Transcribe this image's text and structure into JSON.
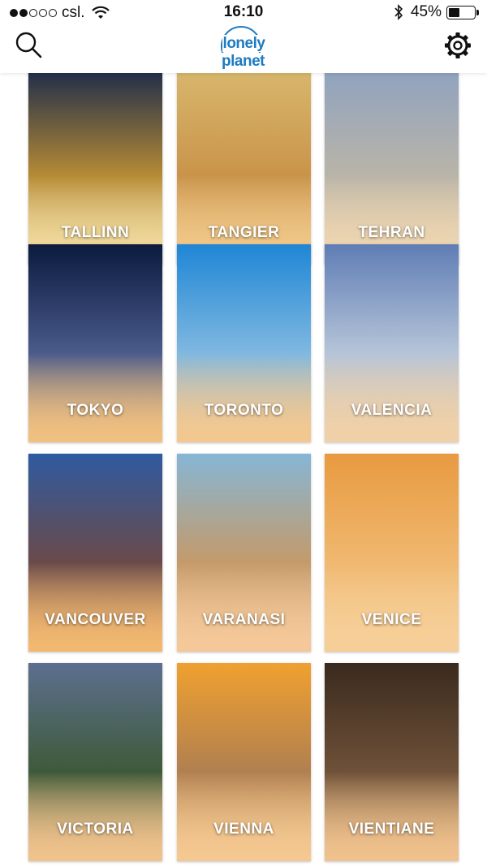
{
  "status_bar": {
    "carrier": "csl.",
    "time": "16:10",
    "battery_percent": "45%",
    "battery_level": 0.45,
    "signal_bars_filled": 2,
    "signal_bars_total": 5
  },
  "header": {
    "logo_text": "lonely planet",
    "left_icon": "search-icon",
    "right_icon": "gear-icon",
    "brand_color": "#1d7bc1"
  },
  "destinations": [
    {
      "name": "TALLINN",
      "theme": [
        "#1a2a4a",
        "#b58a35",
        "#f2dca0"
      ]
    },
    {
      "name": "TANGIER",
      "theme": [
        "#d8b86d",
        "#c9944a",
        "#f1c98a"
      ]
    },
    {
      "name": "TEHRAN",
      "theme": [
        "#8ea2c0",
        "#b9b4a8",
        "#efd6b0"
      ]
    },
    {
      "name": "TOKYO",
      "theme": [
        "#0b1a3e",
        "#4a5a8a",
        "#f0c080"
      ]
    },
    {
      "name": "TORONTO",
      "theme": [
        "#1f86d6",
        "#7fb8e0",
        "#f3c890"
      ]
    },
    {
      "name": "VALENCIA",
      "theme": [
        "#5f7db5",
        "#b5c4d8",
        "#f0d0a8"
      ]
    },
    {
      "name": "VANCOUVER",
      "theme": [
        "#2f5aa0",
        "#6a4a4a",
        "#f2b870"
      ]
    },
    {
      "name": "VARANASI",
      "theme": [
        "#86b6d6",
        "#c49a6a",
        "#f4c898"
      ]
    },
    {
      "name": "VENICE",
      "theme": [
        "#e89a40",
        "#f0b870",
        "#f6cf98"
      ]
    },
    {
      "name": "VICTORIA",
      "theme": [
        "#5d6f8f",
        "#3e5a3a",
        "#f0c28c"
      ]
    },
    {
      "name": "VIENNA",
      "theme": [
        "#f0a030",
        "#b08050",
        "#f4c890"
      ]
    },
    {
      "name": "VIENTIANE",
      "theme": [
        "#3a2a1e",
        "#6e5138",
        "#efc18c"
      ]
    }
  ]
}
